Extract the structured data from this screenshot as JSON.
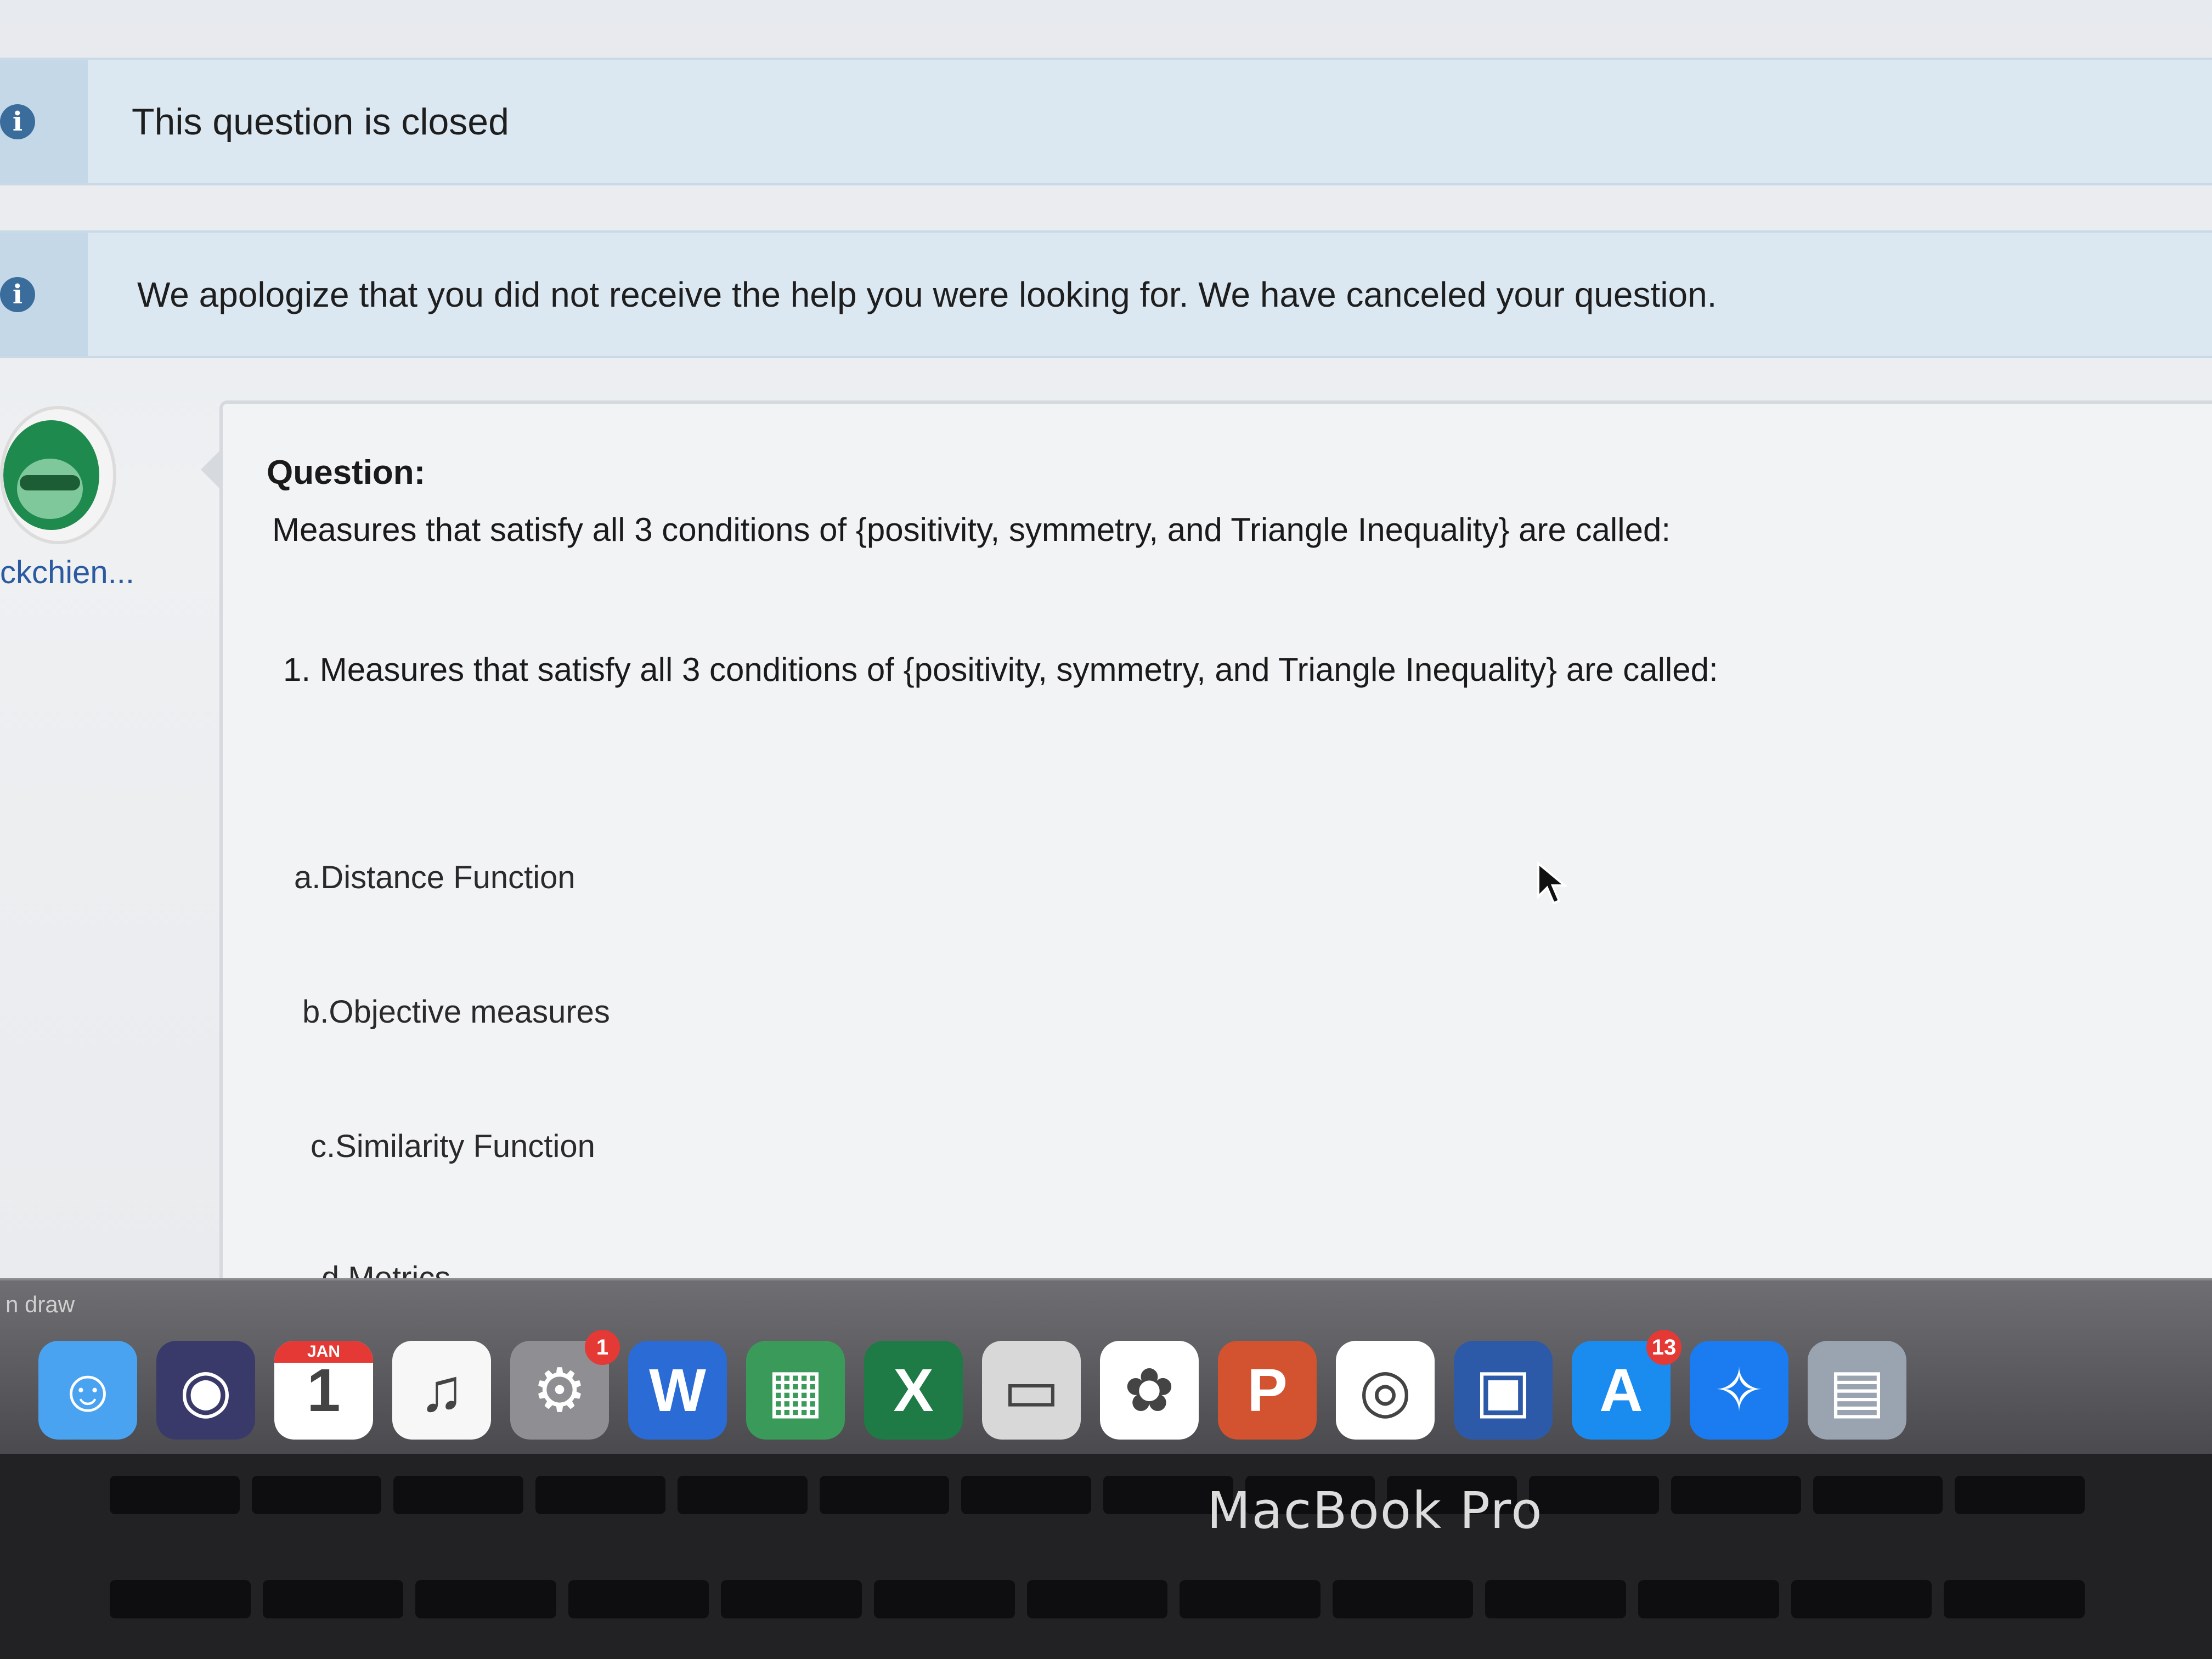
{
  "notices": [
    {
      "text": "This question is closed"
    },
    {
      "text": "We apologize that you did not receive the help you were looking for. We have canceled your question."
    }
  ],
  "asker": {
    "username": "ckchien..."
  },
  "question": {
    "heading": "Question:",
    "body": "Measures that satisfy all 3 conditions of {positivity, symmetry, and Triangle Inequality} are called:",
    "item": "1. Measures that satisfy all 3 conditions of {positivity, symmetry, and Triangle Inequality} are called:",
    "options": [
      {
        "text": "a.Distance Function"
      },
      {
        "text": "b.Objective measures"
      },
      {
        "text": "c.Similarity Function"
      },
      {
        "text": "d.Metrics"
      }
    ]
  },
  "dock": {
    "app_label": "n draw",
    "apps": [
      {
        "name": "finder-icon",
        "color": "#4aa3f0",
        "glyph": "☺"
      },
      {
        "name": "siri-icon",
        "color": "#3a3a6a",
        "glyph": "◉"
      },
      {
        "name": "calendar-icon",
        "color": "#ffffff",
        "glyph": "1",
        "month": "JAN"
      },
      {
        "name": "music-icon",
        "color": "#f7f7f7",
        "glyph": "♫"
      },
      {
        "name": "system-preferences-icon",
        "color": "#8e8e93",
        "glyph": "⚙",
        "badge": "1"
      },
      {
        "name": "word-icon",
        "color": "#2b6bd6",
        "glyph": "W"
      },
      {
        "name": "utilities-icon",
        "color": "#3a9a5a",
        "glyph": "▦"
      },
      {
        "name": "excel-icon",
        "color": "#1e7b45",
        "glyph": "X"
      },
      {
        "name": "preview-icon",
        "color": "#d8d8d8",
        "glyph": "▭"
      },
      {
        "name": "photos-icon",
        "color": "#ffffff",
        "glyph": "✿"
      },
      {
        "name": "powerpoint-icon",
        "color": "#d35230",
        "glyph": "P"
      },
      {
        "name": "chrome-icon",
        "color": "#ffffff",
        "glyph": "◎"
      },
      {
        "name": "virtualbox-icon",
        "color": "#2d5aa8",
        "glyph": "▣"
      },
      {
        "name": "app-store-icon",
        "color": "#1a8cf0",
        "glyph": "A",
        "badge": "13"
      },
      {
        "name": "safari-icon",
        "color": "#1a7cf0",
        "glyph": "✧"
      },
      {
        "name": "image-capture-icon",
        "color": "#9aa4b0",
        "glyph": "▤"
      }
    ]
  },
  "brand": "MacBook Pro"
}
